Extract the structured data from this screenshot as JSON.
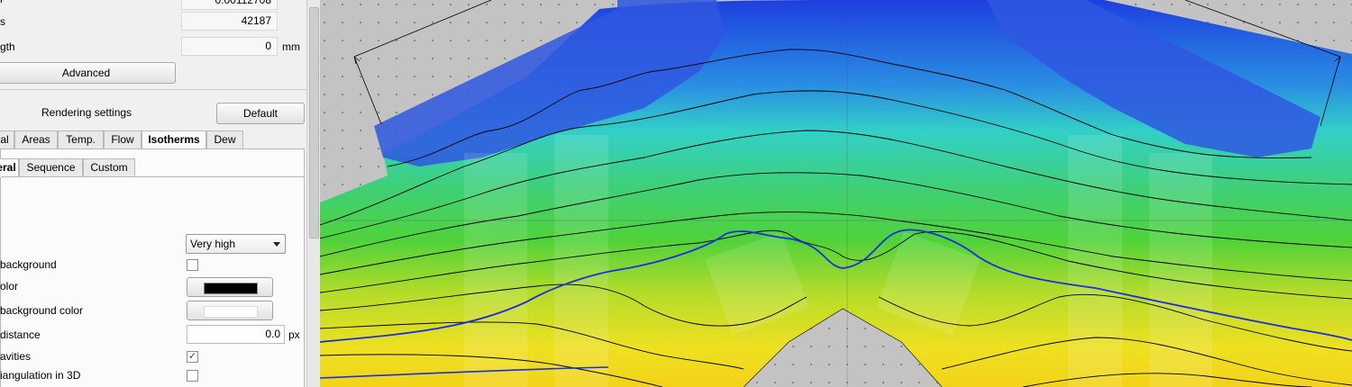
{
  "properties": {
    "row1_label": "r",
    "row1_value": "0.00112708",
    "row2_label": "s",
    "row2_value": "42187",
    "row3_label": "gth",
    "row3_value": "0",
    "row3_unit": "mm",
    "advanced_label": "Advanced"
  },
  "rendering": {
    "title": "Rendering settings",
    "default_label": "Default"
  },
  "tabs": [
    "al",
    "Areas",
    "Temp.",
    "Flow",
    "Isotherms",
    "Dew"
  ],
  "active_tab": "Isotherms",
  "subtabs": [
    "eral",
    "Sequence",
    "Custom"
  ],
  "settings": {
    "quality_value": "Very high",
    "bg_label": "background",
    "color_label": "olor",
    "color_value": "#000000",
    "bgcolor_label": "background color",
    "bgcolor_value": "#ffffff",
    "distance_label": "distance",
    "distance_value": "0.0",
    "distance_unit": "px",
    "cavities_label": "avities",
    "cavities_checked": true,
    "triangulation_label": "iangulation in 3D",
    "triangulation_checked": false
  }
}
